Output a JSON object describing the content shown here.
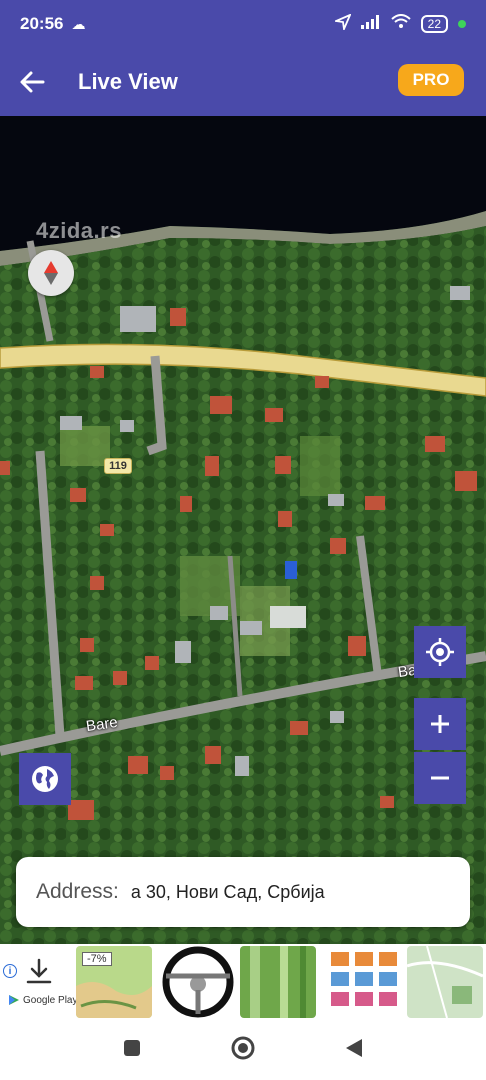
{
  "status_bar": {
    "time": "20:56",
    "battery": "22",
    "icons": [
      "cloud-icon",
      "location-arrow-icon",
      "signal-icon",
      "wifi-icon",
      "battery-icon"
    ]
  },
  "app_bar": {
    "title": "Live View",
    "pro_label": "PRO"
  },
  "map": {
    "watermark": "4zida.rs",
    "road_number": "119",
    "road_labels": [
      "Bare",
      "Bare"
    ]
  },
  "address": {
    "label": "Address:",
    "value": "а 30, Нови Сад, Србија"
  },
  "ad": {
    "discount": "-7%",
    "store_label": "Google Play"
  },
  "colors": {
    "primary": "#4a4aaa",
    "pro": "#f7a81b",
    "road": "#f3e8a8"
  }
}
